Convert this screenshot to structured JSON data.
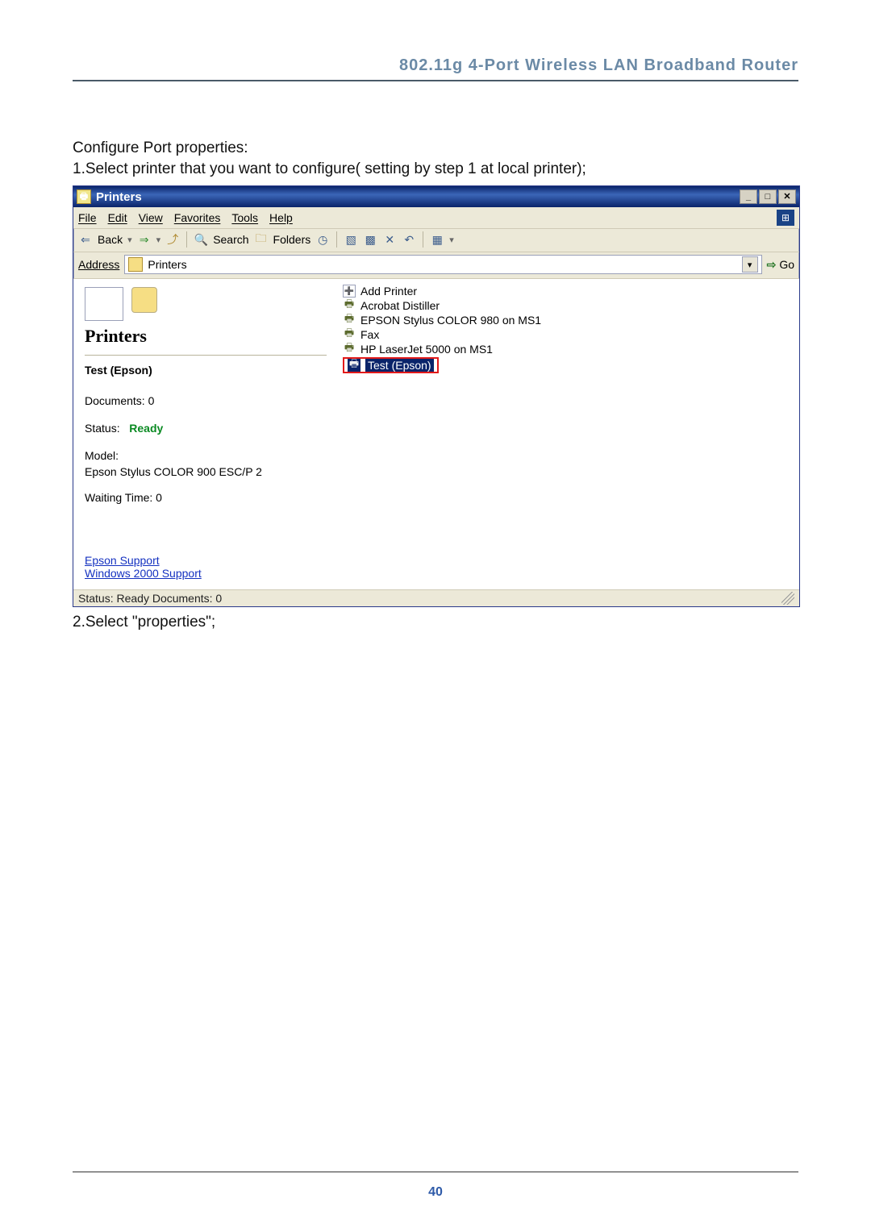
{
  "doc": {
    "header": "802.11g 4-Port Wireless LAN Broadband Router",
    "step_intro": "Configure Port properties:",
    "step1": "1.Select printer that you want to configure( setting by step 1 at local printer);",
    "step2": "2.Select \"properties\";",
    "page_number": "40"
  },
  "window": {
    "title": "Printers",
    "menus": {
      "file": "File",
      "edit": "Edit",
      "view": "View",
      "favorites": "Favorites",
      "tools": "Tools",
      "help": "Help"
    },
    "toolbar": {
      "back": "Back",
      "search": "Search",
      "folders": "Folders"
    },
    "address": {
      "label": "Address",
      "value": "Printers",
      "go": "Go"
    },
    "left": {
      "panel_title": "Printers",
      "selected_name": "Test (Epson)",
      "documents_label": "Documents: 0",
      "status_label": "Status:",
      "status_value": "Ready",
      "model_label": "Model:",
      "model_value": "Epson Stylus COLOR 900 ESC/P 2",
      "waiting": "Waiting Time: 0",
      "link1": "Epson Support",
      "link2": "Windows 2000 Support"
    },
    "items": {
      "add_printer": "Add Printer",
      "acrobat": "Acrobat Distiller",
      "epson_color": "EPSON Stylus COLOR 980 on MS1",
      "fax": "Fax",
      "hp": "HP LaserJet 5000 on MS1",
      "test": "Test (Epson)"
    },
    "statusbar": "Status: Ready Documents: 0"
  }
}
